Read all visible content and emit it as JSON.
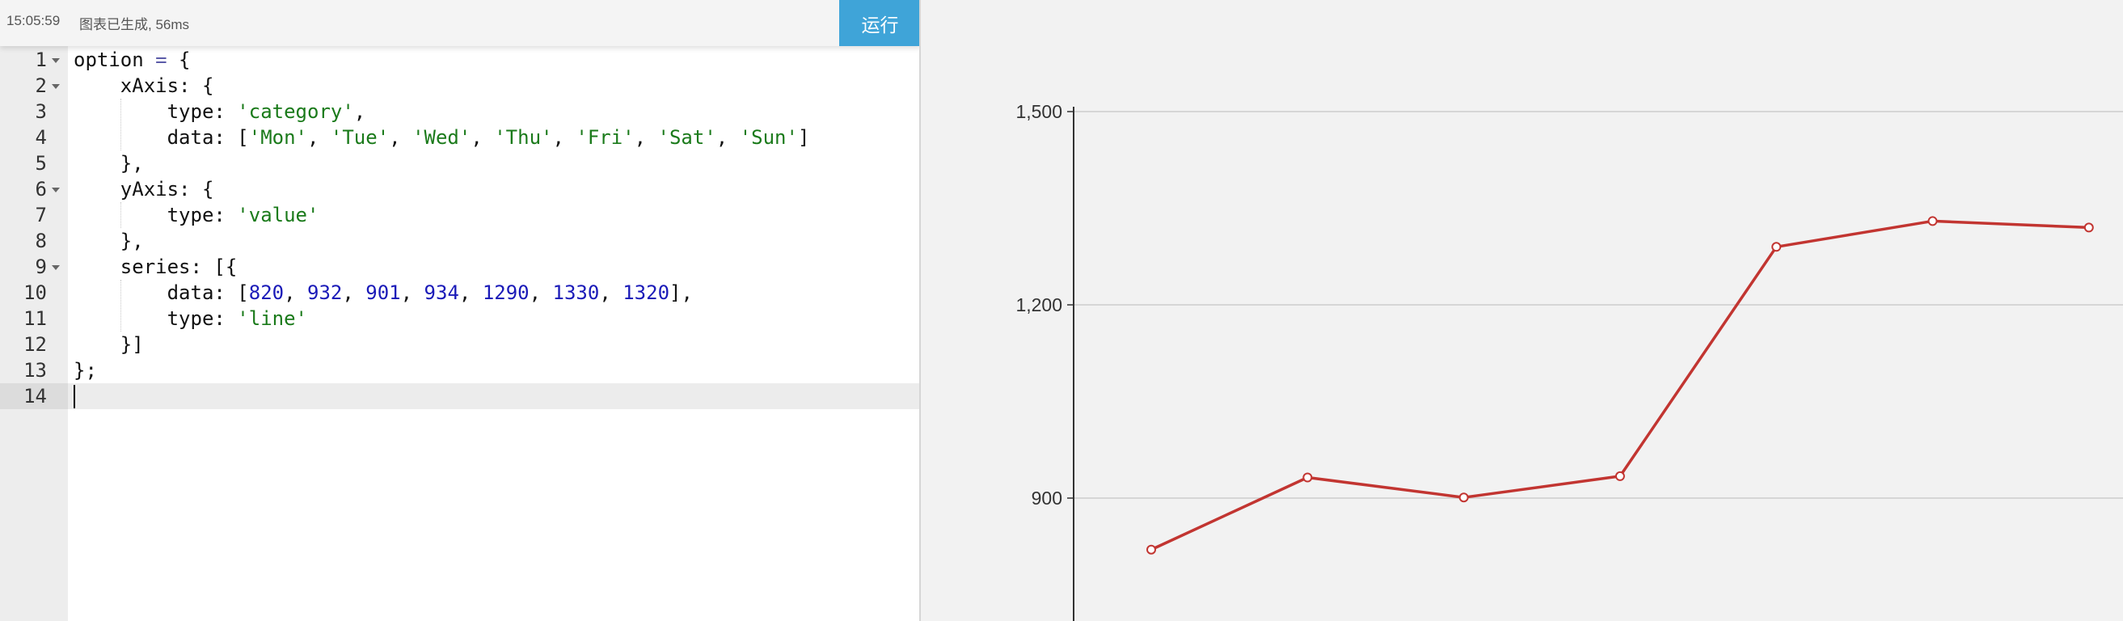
{
  "toolbar": {
    "time": "15:05:59",
    "status": "图表已生成, 56ms",
    "run_label": "运行"
  },
  "editor": {
    "active_line": 14,
    "lines": [
      {
        "n": "1",
        "fold": true,
        "tokens": [
          [
            "plain",
            "option "
          ],
          [
            "op",
            "="
          ],
          [
            "plain",
            " {"
          ]
        ]
      },
      {
        "n": "2",
        "fold": true,
        "tokens": [
          [
            "plain",
            "    xAxis: {"
          ]
        ]
      },
      {
        "n": "3",
        "fold": false,
        "tokens": [
          [
            "plain",
            "        type: "
          ],
          [
            "str",
            "'category'"
          ],
          [
            "plain",
            ","
          ]
        ]
      },
      {
        "n": "4",
        "fold": false,
        "tokens": [
          [
            "plain",
            "        data: ["
          ],
          [
            "str",
            "'Mon'"
          ],
          [
            "plain",
            ", "
          ],
          [
            "str",
            "'Tue'"
          ],
          [
            "plain",
            ", "
          ],
          [
            "str",
            "'Wed'"
          ],
          [
            "plain",
            ", "
          ],
          [
            "str",
            "'Thu'"
          ],
          [
            "plain",
            ", "
          ],
          [
            "str",
            "'Fri'"
          ],
          [
            "plain",
            ", "
          ],
          [
            "str",
            "'Sat'"
          ],
          [
            "plain",
            ", "
          ],
          [
            "str",
            "'Sun'"
          ],
          [
            "plain",
            "]"
          ]
        ]
      },
      {
        "n": "5",
        "fold": false,
        "tokens": [
          [
            "plain",
            "    },"
          ]
        ]
      },
      {
        "n": "6",
        "fold": true,
        "tokens": [
          [
            "plain",
            "    yAxis: {"
          ]
        ]
      },
      {
        "n": "7",
        "fold": false,
        "tokens": [
          [
            "plain",
            "        type: "
          ],
          [
            "str",
            "'value'"
          ]
        ]
      },
      {
        "n": "8",
        "fold": false,
        "tokens": [
          [
            "plain",
            "    },"
          ]
        ]
      },
      {
        "n": "9",
        "fold": true,
        "tokens": [
          [
            "plain",
            "    series: [{"
          ]
        ]
      },
      {
        "n": "10",
        "fold": false,
        "tokens": [
          [
            "plain",
            "        data: ["
          ],
          [
            "num",
            "820"
          ],
          [
            "plain",
            ", "
          ],
          [
            "num",
            "932"
          ],
          [
            "plain",
            ", "
          ],
          [
            "num",
            "901"
          ],
          [
            "plain",
            ", "
          ],
          [
            "num",
            "934"
          ],
          [
            "plain",
            ", "
          ],
          [
            "num",
            "1290"
          ],
          [
            "plain",
            ", "
          ],
          [
            "num",
            "1330"
          ],
          [
            "plain",
            ", "
          ],
          [
            "num",
            "1320"
          ],
          [
            "plain",
            "],"
          ]
        ]
      },
      {
        "n": "11",
        "fold": false,
        "tokens": [
          [
            "plain",
            "        type: "
          ],
          [
            "str",
            "'line'"
          ]
        ]
      },
      {
        "n": "12",
        "fold": false,
        "tokens": [
          [
            "plain",
            "    }]"
          ]
        ]
      },
      {
        "n": "13",
        "fold": false,
        "tokens": [
          [
            "plain",
            "};"
          ]
        ]
      },
      {
        "n": "14",
        "fold": false,
        "tokens": [
          [
            "plain",
            ""
          ]
        ]
      }
    ]
  },
  "chart_data": {
    "type": "line",
    "categories": [
      "Mon",
      "Tue",
      "Wed",
      "Thu",
      "Fri",
      "Sat",
      "Sun"
    ],
    "series": [
      {
        "values": [
          820,
          932,
          901,
          934,
          1290,
          1330,
          1320
        ]
      }
    ],
    "y_ticks": [
      {
        "value": 900,
        "label": "900"
      },
      {
        "value": 1200,
        "label": "1,200"
      },
      {
        "value": 1500,
        "label": "1,500"
      }
    ],
    "ylim": [
      600,
      1500
    ],
    "grid": true,
    "line_color": "#c23531",
    "axis_color": "#333333",
    "grid_color": "#cccccc"
  }
}
